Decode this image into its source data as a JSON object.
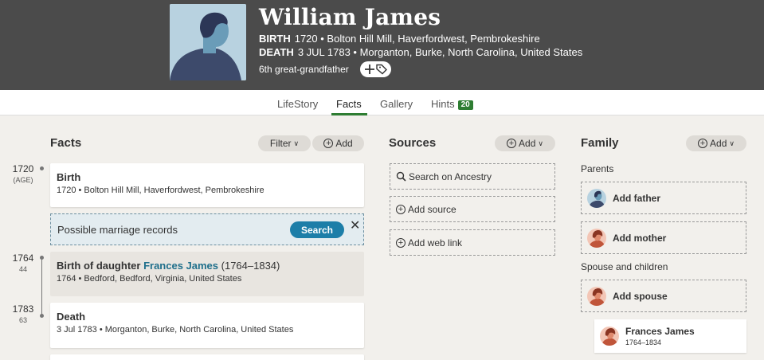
{
  "profile": {
    "name": "William James",
    "birth_label": "BIRTH",
    "birth_value": "1720 • Bolton Hill Mill, Haverfordwest, Pembrokeshire",
    "death_label": "DEATH",
    "death_value": "3 JUL 1783 • Morganton, Burke, North Carolina, United States",
    "relationship": "6th great-grandfather",
    "tag_icon": "plus-tag-icon"
  },
  "tabs": [
    {
      "label": "LifeStory"
    },
    {
      "label": "Facts",
      "active": true
    },
    {
      "label": "Gallery"
    },
    {
      "label": "Hints",
      "badge": "20"
    }
  ],
  "facts": {
    "title": "Facts",
    "filter_label": "Filter",
    "add_label": "Add",
    "timeline": [
      {
        "year": "1720",
        "age": "(AGE)"
      },
      {
        "year": "1764",
        "age": "44"
      },
      {
        "year": "1783",
        "age": "63"
      }
    ],
    "birth": {
      "title": "Birth",
      "detail": "1720 • Bolton Hill Mill, Haverfordwest, Pembrokeshire"
    },
    "hint": {
      "text": "Possible marriage records",
      "button": "Search",
      "close": "✕"
    },
    "daughter": {
      "title_prefix": "Birth of daughter",
      "link": "Frances James",
      "years": "(1764–1834)",
      "detail": "1764 • Bedford, Bedford, Virginia, United States"
    },
    "death": {
      "title": "Death",
      "detail": "3 Jul 1783 • Morganton, Burke, North Carolina, United States"
    }
  },
  "sources": {
    "title": "Sources",
    "add_label": "Add",
    "search_label": "Search on Ancestry",
    "add_source_label": "Add source",
    "add_weblink_label": "Add web link"
  },
  "family": {
    "title": "Family",
    "add_label": "Add",
    "parents_label": "Parents",
    "add_father": "Add father",
    "add_mother": "Add mother",
    "spouse_label": "Spouse and children",
    "add_spouse": "Add spouse",
    "child": {
      "name": "Frances James",
      "lifespan": "1764–1834"
    }
  },
  "colors": {
    "header_bg": "#4b4b4b",
    "accent_green": "#2e7d32",
    "link_blue": "#1f6f8b",
    "button_blue": "#1d7ea8",
    "hint_bg": "#e3ecf0"
  }
}
